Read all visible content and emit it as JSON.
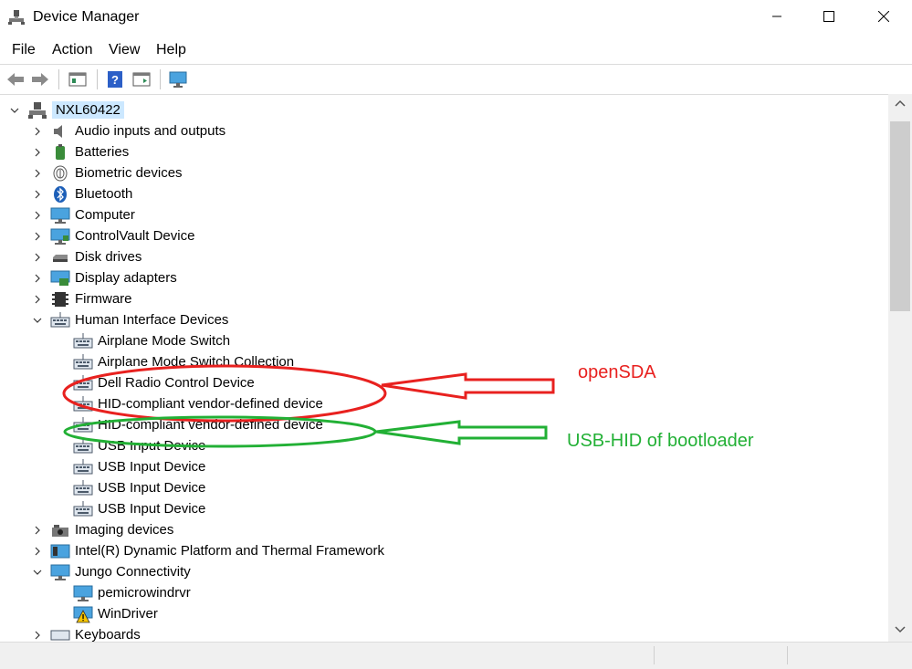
{
  "window": {
    "title": "Device Manager",
    "buttons": [
      "minimize",
      "maximize",
      "close"
    ]
  },
  "menu": [
    {
      "label": "File"
    },
    {
      "label": "Action"
    },
    {
      "label": "View"
    },
    {
      "label": "Help"
    }
  ],
  "toolbar": {
    "icons": [
      "back-arrow-icon",
      "forward-arrow-icon",
      "properties-pane-icon",
      "help-icon",
      "run-pane-icon",
      "monitor-scan-icon"
    ]
  },
  "tree": {
    "root": "NXL60422",
    "categories": [
      {
        "label": "Audio inputs and outputs",
        "expanded": false
      },
      {
        "label": "Batteries",
        "expanded": false
      },
      {
        "label": "Biometric devices",
        "expanded": false
      },
      {
        "label": "Bluetooth",
        "expanded": false
      },
      {
        "label": "Computer",
        "expanded": false
      },
      {
        "label": "ControlVault Device",
        "expanded": false
      },
      {
        "label": "Disk drives",
        "expanded": false
      },
      {
        "label": "Display adapters",
        "expanded": false
      },
      {
        "label": "Firmware",
        "expanded": false
      },
      {
        "label": "Human Interface Devices",
        "expanded": true
      },
      {
        "label": "Airplane Mode Switch",
        "child": true
      },
      {
        "label": "Airplane Mode Switch Collection",
        "child": true
      },
      {
        "label": "Dell Radio Control Device",
        "child": true
      },
      {
        "label": "HID-compliant vendor-defined device",
        "child": true
      },
      {
        "label": "HID-compliant vendor-defined device",
        "child": true
      },
      {
        "label": "USB Input Device",
        "child": true
      },
      {
        "label": "USB Input Device",
        "child": true
      },
      {
        "label": "USB Input Device",
        "child": true
      },
      {
        "label": "USB Input Device",
        "child": true
      },
      {
        "label": "Imaging devices",
        "expanded": false
      },
      {
        "label": "Intel(R) Dynamic Platform and Thermal Framework",
        "expanded": false
      },
      {
        "label": "Jungo Connectivity",
        "expanded": true
      },
      {
        "label": "pemicrowindrvr",
        "child": true
      },
      {
        "label": "WinDriver",
        "child": true
      },
      {
        "label": "Keyboards",
        "expanded": false
      }
    ]
  },
  "annotations": {
    "opensda": {
      "label": "openSDA",
      "color": "#e8211f"
    },
    "usbhid": {
      "label": "USB-HID of bootloader",
      "color": "#22b035"
    }
  }
}
